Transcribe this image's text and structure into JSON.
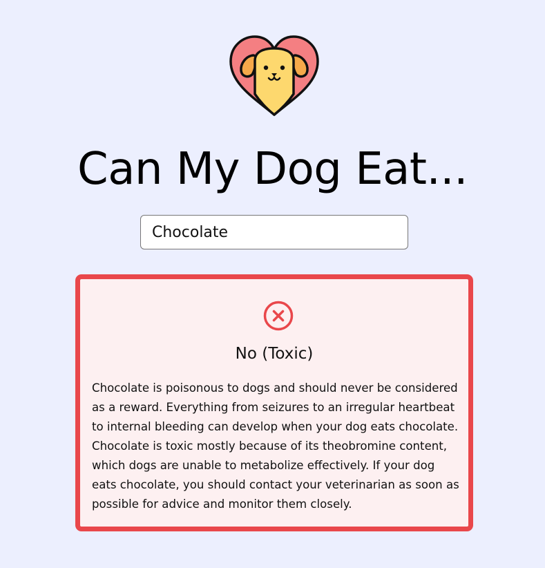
{
  "logo_icon": "dog-heart-icon",
  "title": "Can My Dog Eat...",
  "search": {
    "value": "Chocolate"
  },
  "result": {
    "status_icon": "x-circle-icon",
    "verdict": "No (Toxic)",
    "description": "Chocolate is poisonous to dogs and should never be considered as a reward. Everything from seizures to an irregular heartbeat to internal bleeding can develop when your dog eats chocolate. Chocolate is toxic mostly because of its theobromine content, which dogs are unable to metabolize effectively. If your dog eats chocolate, you should contact your veterinarian as soon as possible for advice and monitor them closely.",
    "accent_color": "#e9474b",
    "background_color": "#fdf0f1"
  },
  "page_background": "#eceffe"
}
